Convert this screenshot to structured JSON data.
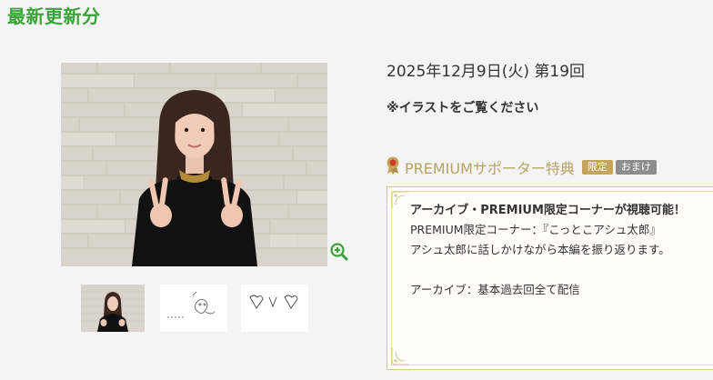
{
  "section_title": "最新更新分",
  "episode": {
    "date_line": "2025年12月9日(火) 第19回",
    "notice": "※イラストをご覧ください"
  },
  "gallery": {
    "main_image": "portrait-photo",
    "zoom_icon": "zoom-in-icon",
    "thumbnails": [
      "portrait-thumb",
      "illustration-thumb",
      "drawing-thumb"
    ]
  },
  "premium": {
    "icon": "award-ribbon-icon",
    "title": "PREMIUMサポーター特典",
    "badge_limited": "限定",
    "badge_bonus": "おまけ",
    "heading": "アーカイブ・PREMIUM限定コーナーが視聴可能！",
    "line1": "PREMIUM限定コーナー：『こっとこアシュ太郎』",
    "line2": "アシュ太郎に話しかけながら本編を振り返ります。",
    "line3": "アーカイブ：基本過去回全て配信"
  },
  "colors": {
    "title_green": "#3aa339",
    "gold": "#c2a55a",
    "gray_badge": "#8d8d8d"
  }
}
